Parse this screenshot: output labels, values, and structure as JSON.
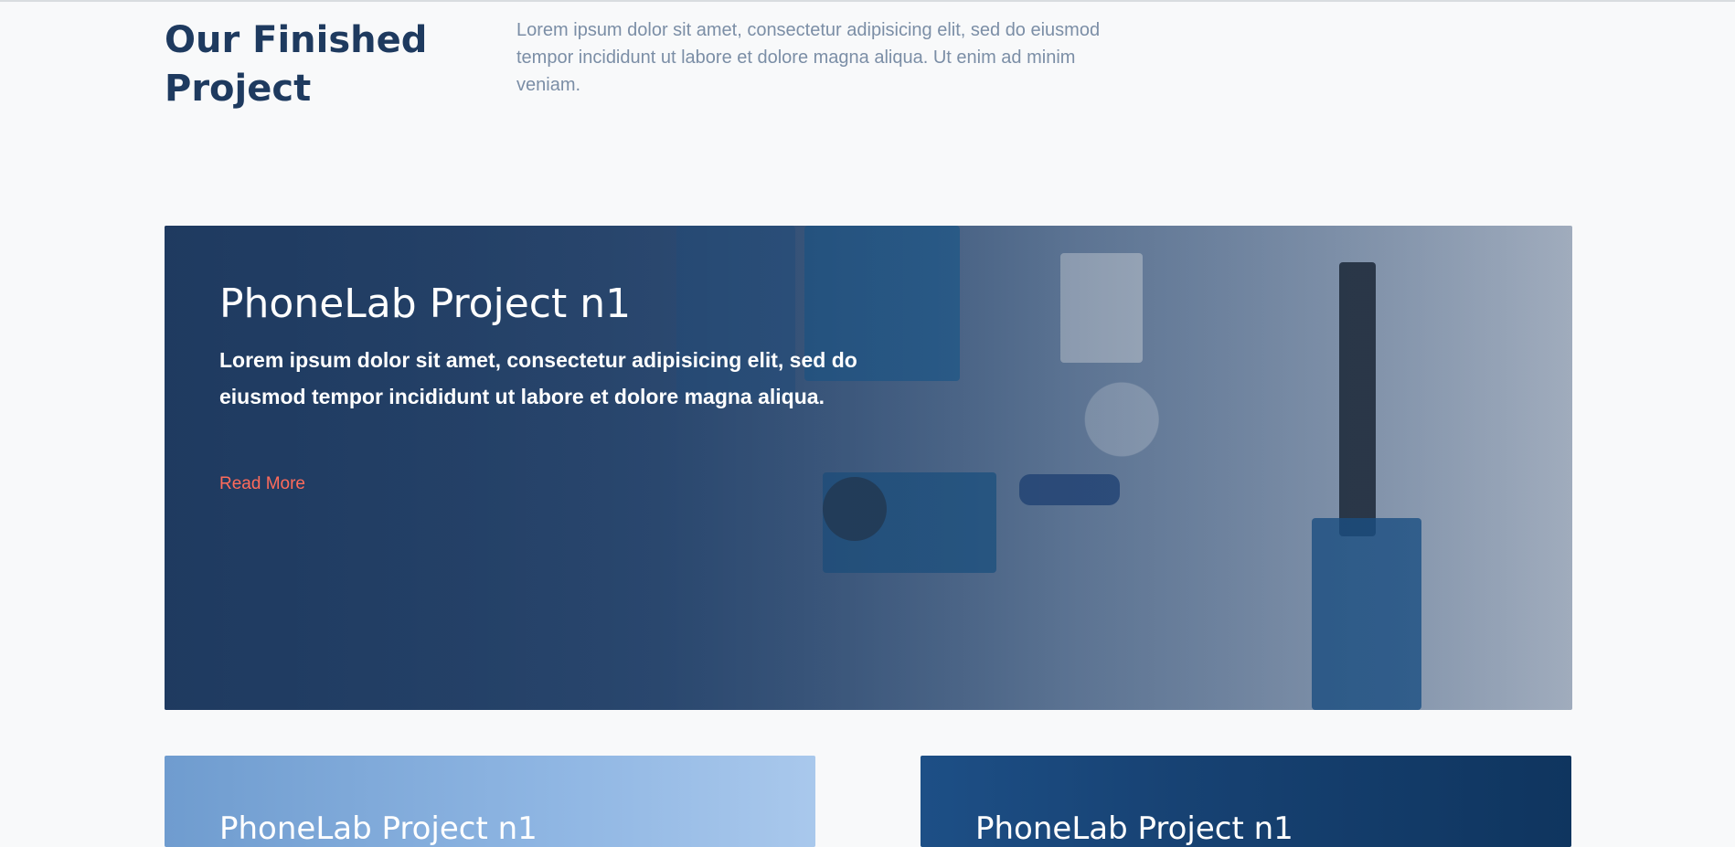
{
  "section": {
    "title": "Our Finished Project",
    "description": "Lorem ipsum dolor sit amet, consectetur adipisicing elit, sed do eiusmod tempor incididunt ut labore et dolore magna aliqua. Ut enim ad minim veniam."
  },
  "projects": [
    {
      "title": "PhoneLab Project n1",
      "text": "Lorem ipsum dolor sit amet, consectetur adipisicing elit, sed do eiusmod tempor incididunt ut labore et dolore magna aliqua.",
      "link": "Read More"
    },
    {
      "title": "PhoneLab Project n1"
    },
    {
      "title": "PhoneLab Project n1"
    }
  ],
  "colors": {
    "heading": "#1e3a5f",
    "muted_text": "#7b8ea6",
    "accent": "#ff6b5b",
    "background": "#f8f9fa"
  }
}
